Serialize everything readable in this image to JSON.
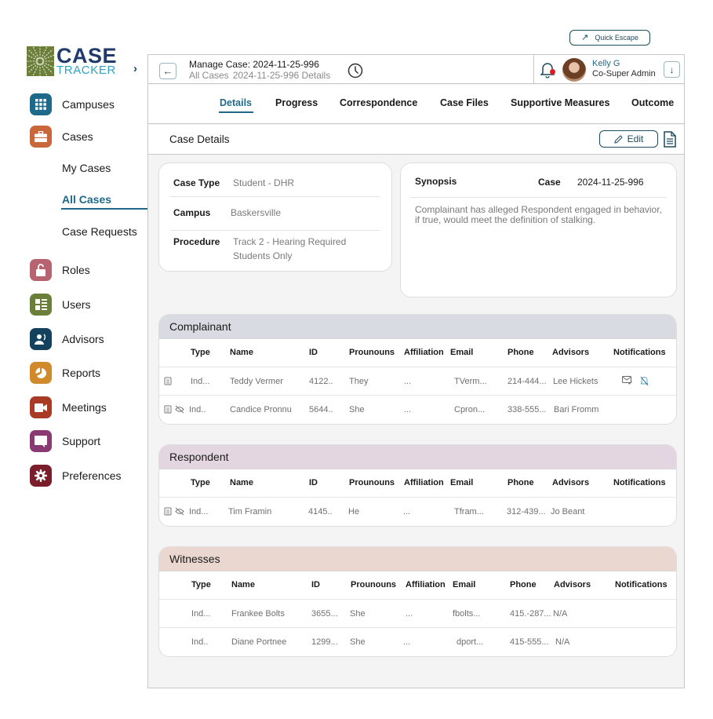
{
  "quick_escape": {
    "label": "Quick Escape",
    "icon": "arrow-up-left-icon"
  },
  "logo": {
    "line1": "CASE",
    "line2": "TRACKER"
  },
  "sidebar": {
    "toggle_icon": "chevron-right-icon",
    "items": [
      {
        "label": "Campuses",
        "icon": "grid-icon",
        "color": "#1f6a8a"
      },
      {
        "label": "Cases",
        "icon": "briefcase-icon",
        "color": "#c9673a"
      },
      {
        "label": "Roles",
        "icon": "lock-open-icon",
        "color": "#b86470"
      },
      {
        "label": "Users",
        "icon": "user-list-icon",
        "color": "#6b7f3a"
      },
      {
        "label": "Advisors",
        "icon": "advisors-icon",
        "color": "#14425e"
      },
      {
        "label": "Reports",
        "icon": "pie-chart-icon",
        "color": "#d08a2c"
      },
      {
        "label": "Meetings",
        "icon": "video-icon",
        "color": "#a83a26"
      },
      {
        "label": "Support",
        "icon": "chat-icon",
        "color": "#8a3a72"
      },
      {
        "label": "Preferences",
        "icon": "gear-icon",
        "color": "#7b1e2b"
      }
    ],
    "sub_items": [
      {
        "label": "My Cases",
        "active": false
      },
      {
        "label": "All Cases",
        "active": true
      },
      {
        "label": "Case Requests",
        "active": false
      }
    ]
  },
  "header": {
    "title": "Manage Case: 2024-11-25-996",
    "breadcrumb": [
      "All Cases",
      "2024-11-25-996 Details"
    ],
    "user": {
      "name": "Kelly G",
      "role": "Co-Super Admin"
    }
  },
  "tabs": [
    {
      "label": "Details",
      "active": true
    },
    {
      "label": "Progress",
      "active": false
    },
    {
      "label": "Correspondence",
      "active": false
    },
    {
      "label": "Case Files",
      "active": false
    },
    {
      "label": "Supportive Measures",
      "active": false
    },
    {
      "label": "Outcome",
      "active": false
    }
  ],
  "section": {
    "title": "Case Details",
    "edit_label": "Edit"
  },
  "case_info": {
    "rows": [
      {
        "label": "Case Type",
        "value": "Student - DHR"
      },
      {
        "label": "Campus",
        "value": "Baskersville"
      },
      {
        "label": "Procedure",
        "value": "Track 2 - Hearing Required Students Only"
      }
    ]
  },
  "synopsis": {
    "label": "Synopsis",
    "case_label": "Case",
    "case_value": "2024-11-25-996",
    "text": "Complainant has alleged Respondent engaged in behavior, if true, would meet the definition of stalking."
  },
  "columns": [
    "Type",
    "Name",
    "ID",
    "Prounouns",
    "Affiliation",
    "Email",
    "Phone",
    "Advisors",
    "Notifications"
  ],
  "complainant": {
    "title": "Complainant",
    "rows": [
      {
        "type": "Ind...",
        "name": "Teddy Vermer",
        "id": "4122..",
        "pronouns": "They",
        "affiliation": "...",
        "email": "TVerm...",
        "phone": "214-444...",
        "advisor": "Lee Hickets",
        "icons": [
          "document-icon"
        ],
        "notifications": [
          "mail-check-icon",
          "bell-off-icon"
        ]
      },
      {
        "type": "Ind..",
        "name": "Candice Pronnu",
        "id": "5644..",
        "pronouns": "She",
        "affiliation": "...",
        "email": "Cpron...",
        "phone": "338-555...",
        "advisor": "Bari Fromm",
        "icons": [
          "document-icon",
          "eye-off-icon"
        ],
        "notifications": []
      }
    ]
  },
  "respondent": {
    "title": "Respondent",
    "rows": [
      {
        "type": "Ind...",
        "name": "Tim Framin",
        "id": "4145..",
        "pronouns": "He",
        "affiliation": "...",
        "email": "Tfram...",
        "phone": "312-439...",
        "advisor": "Jo Beant",
        "icons": [
          "document-icon",
          "eye-off-icon"
        ],
        "notifications": []
      }
    ]
  },
  "witnesses": {
    "title": "Witnesses",
    "rows": [
      {
        "type": "Ind...",
        "name": "Frankee Bolts",
        "id": "3655...",
        "pronouns": "She",
        "affiliation": "...",
        "email": "fbolts...",
        "phone": "415.-287...",
        "advisor": "N/A",
        "icons": [],
        "notifications": []
      },
      {
        "type": "Ind..",
        "name": "Diane Portnee",
        "id": "1299...",
        "pronouns": "She",
        "affiliation": "...",
        "email": "dport...",
        "phone": "415-555...",
        "advisor": "N/A",
        "icons": [],
        "notifications": []
      }
    ]
  }
}
